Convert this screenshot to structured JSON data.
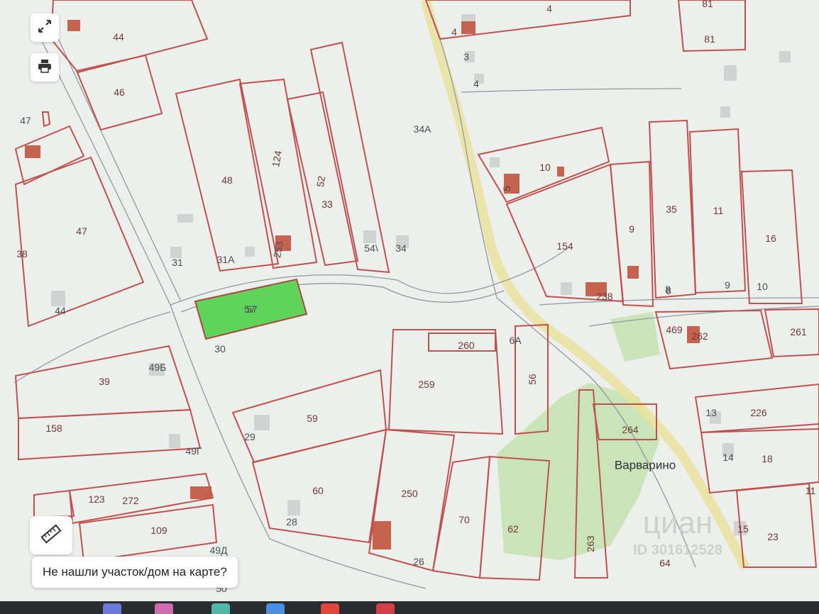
{
  "map": {
    "plots": [
      "44",
      "46",
      "47",
      "47",
      "38",
      "44",
      "48",
      "124",
      "52",
      "33",
      "34А",
      "31",
      "31А",
      "253",
      "54\\",
      "34",
      "57",
      "30",
      "39",
      "49Б",
      "158",
      "49Г",
      "29",
      "59",
      "60",
      "28",
      "123",
      "272",
      "109",
      "49Д",
      "50",
      "4",
      "4",
      "3",
      "4",
      "81",
      "81",
      "10",
      "5",
      "154",
      "238",
      "9",
      "35",
      "11",
      "16",
      "8",
      "8",
      "9",
      "10",
      "469",
      "262",
      "261",
      "260",
      "6А",
      "259",
      "56",
      "250",
      "70",
      "62",
      "263",
      "264",
      "64",
      "13",
      "226",
      "14",
      "18",
      "23",
      "11",
      "15",
      "26"
    ],
    "highlighted_plot": "57",
    "place_name": "Варварино",
    "watermark": {
      "brand": "циан",
      "id": "ID 301612528"
    }
  },
  "controls": {
    "fullscreen": "expand-icon",
    "print": "printer-icon",
    "ruler": "ruler-icon"
  },
  "hint": "Не нашли участок/дом на карте?",
  "colors": {
    "boundary": "#c0514e",
    "highlight": "#5fd35a",
    "green_area": "#bfe0a8"
  }
}
